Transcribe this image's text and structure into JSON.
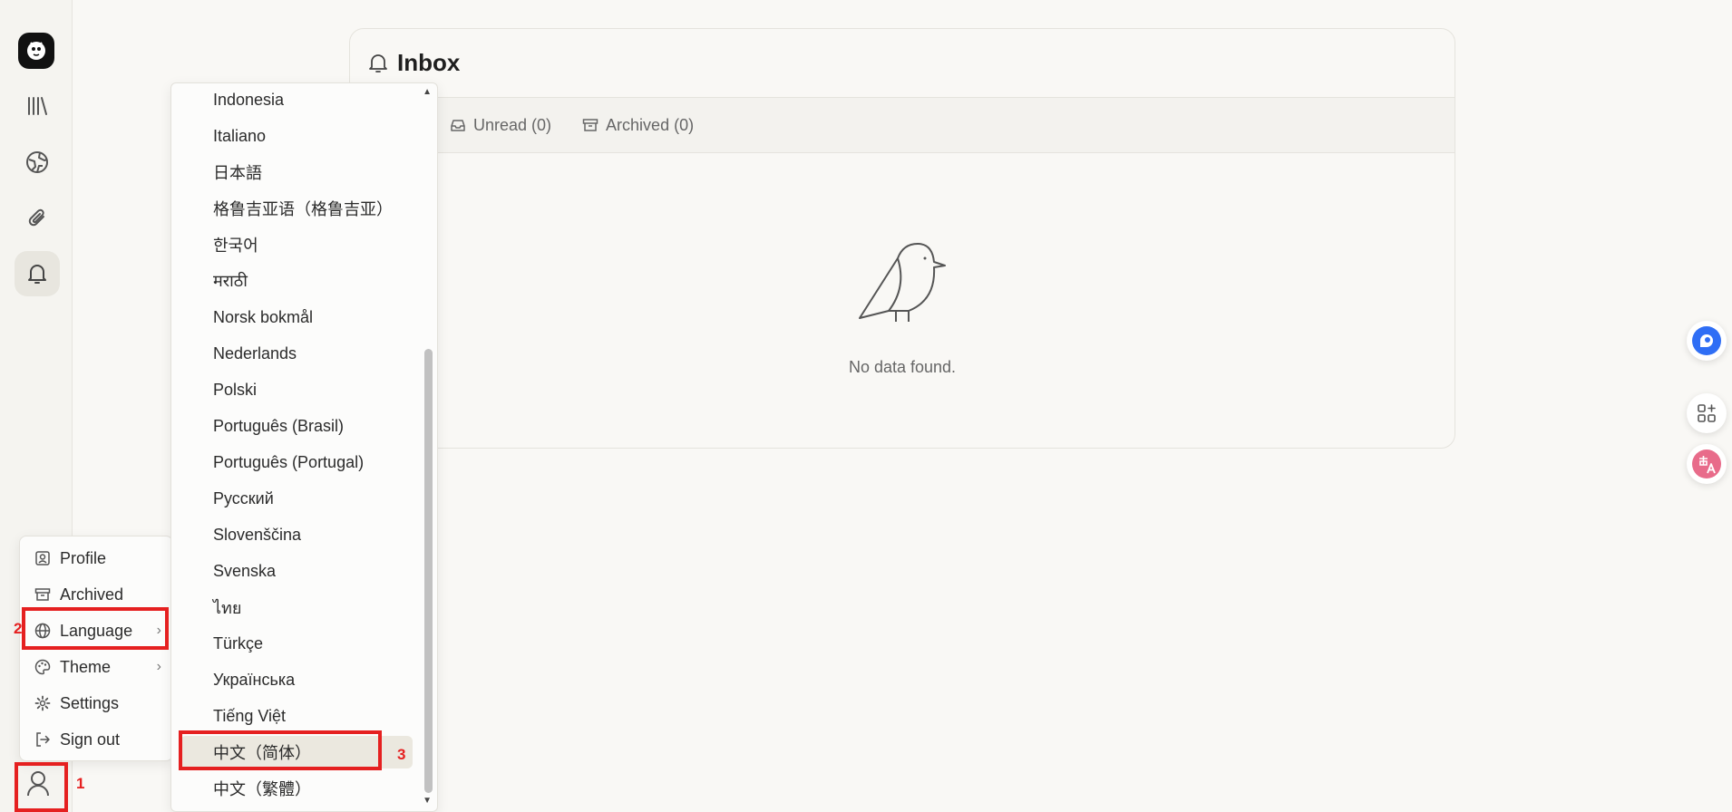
{
  "inbox": {
    "title": "Inbox",
    "tabs": [
      {
        "label": "Unread (0)",
        "icon": "inbox-tray-icon"
      },
      {
        "label": "Archived (0)",
        "icon": "archive-box-icon"
      }
    ],
    "empty_text": "No data found."
  },
  "user_menu": {
    "items": [
      {
        "label": "Profile",
        "icon": "profile-card-icon"
      },
      {
        "label": "Archived",
        "icon": "archive-box-icon"
      },
      {
        "label": "Language",
        "icon": "globe-icon",
        "submenu": true
      },
      {
        "label": "Theme",
        "icon": "palette-icon",
        "submenu": true
      },
      {
        "label": "Settings",
        "icon": "gear-icon"
      },
      {
        "label": "Sign out",
        "icon": "sign-out-icon"
      }
    ]
  },
  "language_menu": {
    "items": [
      "Indonesia",
      "Italiano",
      "日本語",
      "格鲁吉亚语（格鲁吉亚）",
      "한국어",
      "मराठी",
      "Norsk bokmål",
      "Nederlands",
      "Polski",
      "Português (Brasil)",
      "Português (Portugal)",
      "Русский",
      "Slovenščina",
      "Svenska",
      "ไทย",
      "Türkçe",
      "Українська",
      "Tiếng Việt",
      "中文（简体）",
      "中文（繁體）"
    ],
    "selected": "中文（简体）"
  },
  "annotations": [
    "1",
    "2",
    "3"
  ],
  "colors": {
    "annotation": "#e52020",
    "accent_blue": "#2f6ef5",
    "translate_pink": "#e86b8a"
  }
}
